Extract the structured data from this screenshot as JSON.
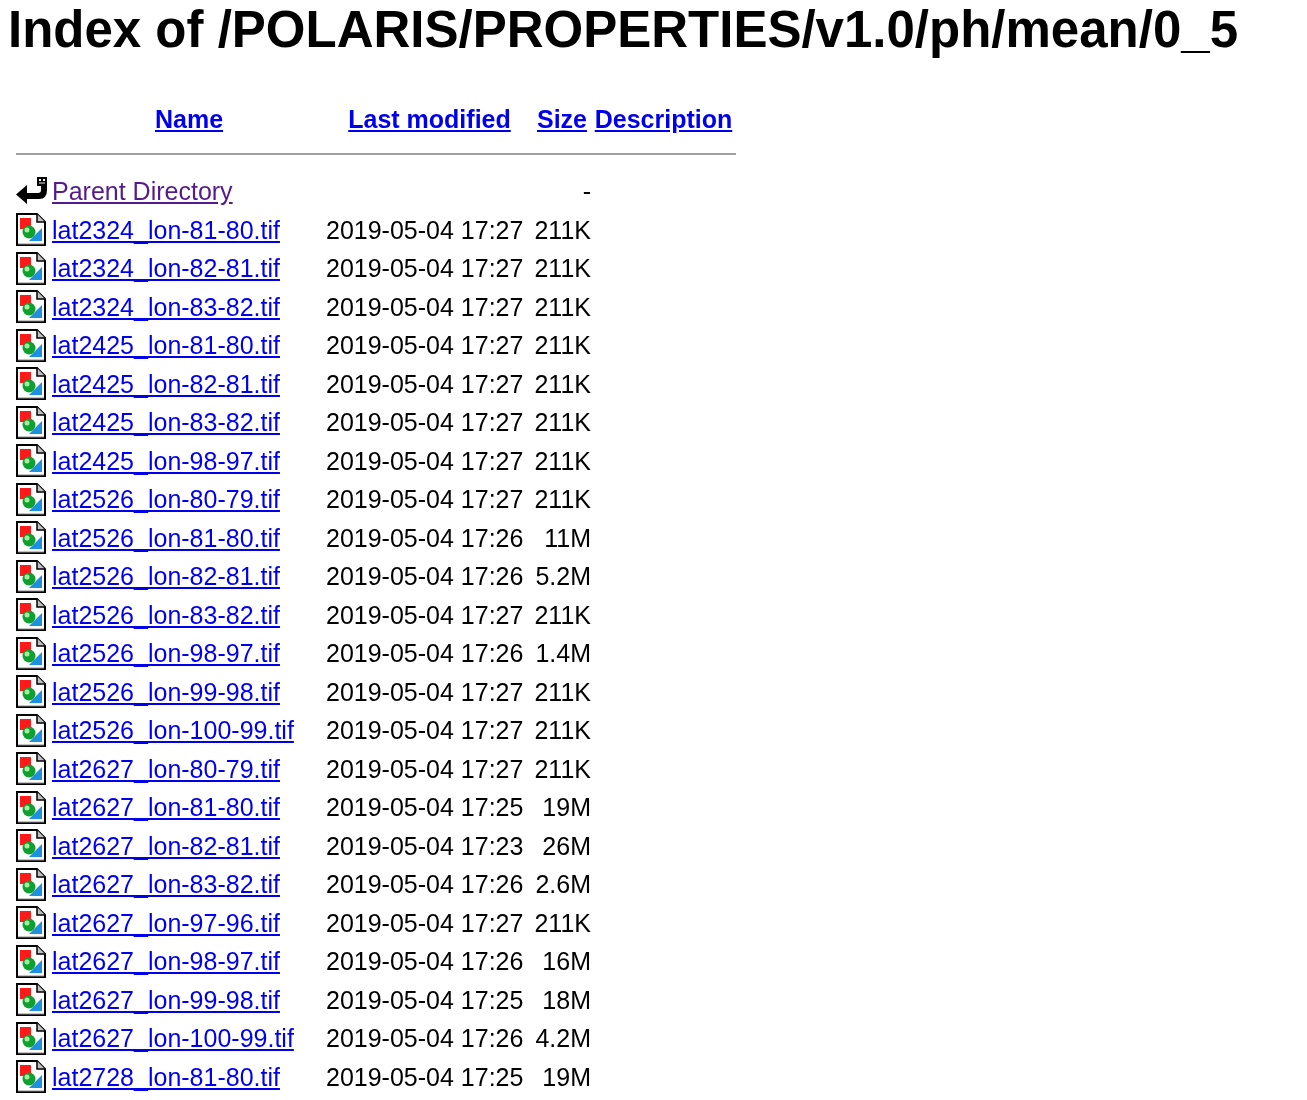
{
  "title": "Index of /POLARIS/PROPERTIES/v1.0/ph/mean/0_5",
  "table": {
    "columns": [
      "Name",
      "Last modified",
      "Size",
      "Description"
    ],
    "rows": [
      {
        "kind": "parent",
        "name": "Parent Directory",
        "size": "-",
        "visited": true
      },
      {
        "kind": "image",
        "name": "lat2324_lon-81-80.tif",
        "last_modified": "2019-05-04 17:27",
        "size": "211K",
        "visited": false
      },
      {
        "kind": "image",
        "name": "lat2324_lon-82-81.tif",
        "last_modified": "2019-05-04 17:27",
        "size": "211K",
        "visited": false
      },
      {
        "kind": "image",
        "name": "lat2324_lon-83-82.tif",
        "last_modified": "2019-05-04 17:27",
        "size": "211K",
        "visited": false
      },
      {
        "kind": "image",
        "name": "lat2425_lon-81-80.tif",
        "last_modified": "2019-05-04 17:27",
        "size": "211K",
        "visited": false
      },
      {
        "kind": "image",
        "name": "lat2425_lon-82-81.tif",
        "last_modified": "2019-05-04 17:27",
        "size": "211K",
        "visited": false
      },
      {
        "kind": "image",
        "name": "lat2425_lon-83-82.tif",
        "last_modified": "2019-05-04 17:27",
        "size": "211K",
        "visited": false
      },
      {
        "kind": "image",
        "name": "lat2425_lon-98-97.tif",
        "last_modified": "2019-05-04 17:27",
        "size": "211K",
        "visited": false
      },
      {
        "kind": "image",
        "name": "lat2526_lon-80-79.tif",
        "last_modified": "2019-05-04 17:27",
        "size": "211K",
        "visited": false
      },
      {
        "kind": "image",
        "name": "lat2526_lon-81-80.tif",
        "last_modified": "2019-05-04 17:26",
        "size": "11M",
        "visited": false
      },
      {
        "kind": "image",
        "name": "lat2526_lon-82-81.tif",
        "last_modified": "2019-05-04 17:26",
        "size": "5.2M",
        "visited": false
      },
      {
        "kind": "image",
        "name": "lat2526_lon-83-82.tif",
        "last_modified": "2019-05-04 17:27",
        "size": "211K",
        "visited": false
      },
      {
        "kind": "image",
        "name": "lat2526_lon-98-97.tif",
        "last_modified": "2019-05-04 17:26",
        "size": "1.4M",
        "visited": false
      },
      {
        "kind": "image",
        "name": "lat2526_lon-99-98.tif",
        "last_modified": "2019-05-04 17:27",
        "size": "211K",
        "visited": false
      },
      {
        "kind": "image",
        "name": "lat2526_lon-100-99.tif",
        "last_modified": "2019-05-04 17:27",
        "size": "211K",
        "visited": false
      },
      {
        "kind": "image",
        "name": "lat2627_lon-80-79.tif",
        "last_modified": "2019-05-04 17:27",
        "size": "211K",
        "visited": false
      },
      {
        "kind": "image",
        "name": "lat2627_lon-81-80.tif",
        "last_modified": "2019-05-04 17:25",
        "size": "19M",
        "visited": false
      },
      {
        "kind": "image",
        "name": "lat2627_lon-82-81.tif",
        "last_modified": "2019-05-04 17:23",
        "size": "26M",
        "visited": false
      },
      {
        "kind": "image",
        "name": "lat2627_lon-83-82.tif",
        "last_modified": "2019-05-04 17:26",
        "size": "2.6M",
        "visited": false
      },
      {
        "kind": "image",
        "name": "lat2627_lon-97-96.tif",
        "last_modified": "2019-05-04 17:27",
        "size": "211K",
        "visited": false
      },
      {
        "kind": "image",
        "name": "lat2627_lon-98-97.tif",
        "last_modified": "2019-05-04 17:26",
        "size": "16M",
        "visited": false
      },
      {
        "kind": "image",
        "name": "lat2627_lon-99-98.tif",
        "last_modified": "2019-05-04 17:25",
        "size": "18M",
        "visited": false
      },
      {
        "kind": "image",
        "name": "lat2627_lon-100-99.tif",
        "last_modified": "2019-05-04 17:26",
        "size": "4.2M",
        "visited": false
      },
      {
        "kind": "image",
        "name": "lat2728_lon-81-80.tif",
        "last_modified": "2019-05-04 17:25",
        "size": "19M",
        "visited": false
      }
    ]
  }
}
